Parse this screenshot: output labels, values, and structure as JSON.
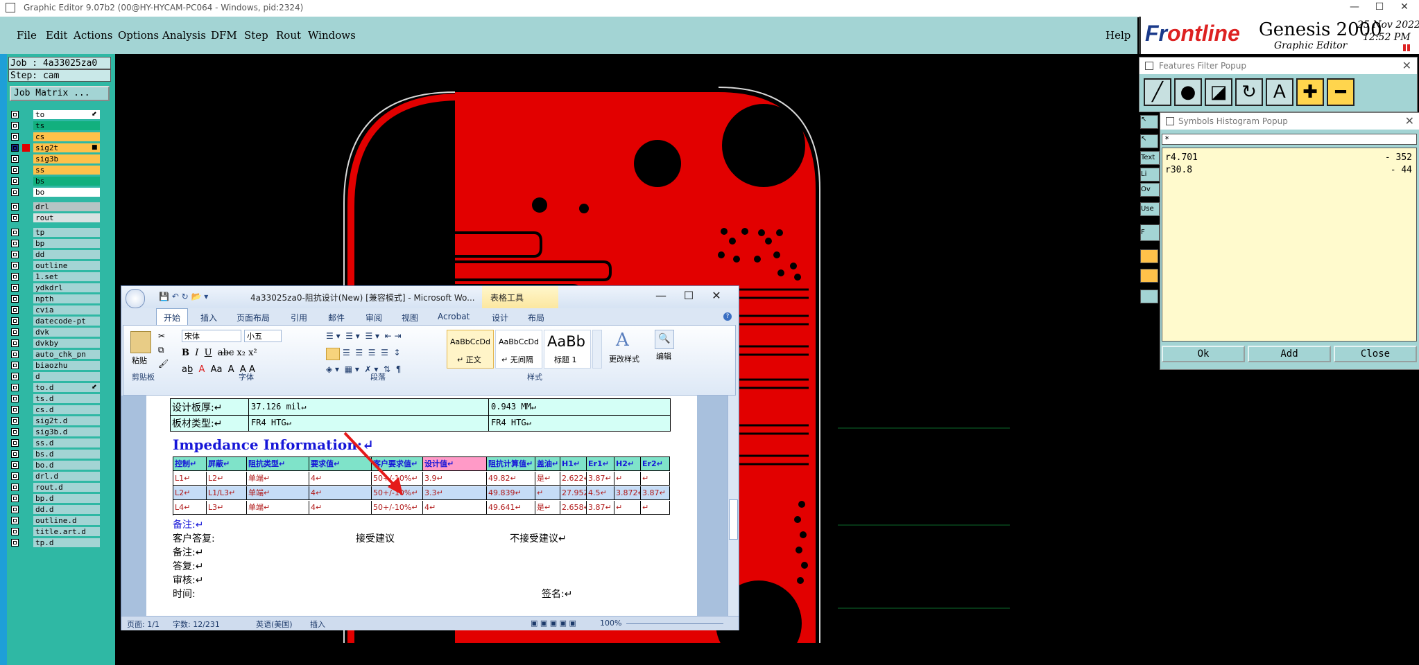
{
  "frame": {
    "title": "Graphic Editor 9.07b2 (00@HY-HYCAM-PC064 - Windows, pid:2324)"
  },
  "menu": {
    "items": [
      "File",
      "Edit",
      "Actions",
      "Options",
      "Analysis",
      "DFM",
      "Step",
      "Rout",
      "Windows"
    ],
    "help": "Help"
  },
  "logo": {
    "brand_front": "Fr",
    "brand_rest": "ontline",
    "product": "Genesis 2000",
    "subtitle": "Graphic Editor",
    "date": "25 Nov 2022",
    "time": "12:52 PM"
  },
  "job": {
    "job_label": "Job : 4a33025za0",
    "step_label": "Step: cam",
    "matrix_button": "Job Matrix ..."
  },
  "layers": [
    {
      "name": "to",
      "color": "#ffffff",
      "mark": "⬋"
    },
    {
      "name": "ts",
      "color": "#12b07e",
      "mark": ""
    },
    {
      "name": "cs",
      "color": "#ffc14a",
      "mark": ""
    },
    {
      "name": "sig2t",
      "color": "#ffc14a",
      "mark": "■",
      "selected": true
    },
    {
      "name": "sig3b",
      "color": "#ffc14a",
      "mark": ""
    },
    {
      "name": "ss",
      "color": "#ffc14a",
      "mark": ""
    },
    {
      "name": "bs",
      "color": "#12b07e",
      "mark": ""
    },
    {
      "name": "bo",
      "color": "#ffffff",
      "mark": ""
    },
    {
      "name": "drl",
      "color": "#b6c4c4",
      "mark": ""
    },
    {
      "name": "rout",
      "color": "#d8e2e2",
      "mark": ""
    },
    {
      "name": "tp",
      "color": "#a3d4d4",
      "mark": ""
    },
    {
      "name": "bp",
      "color": "#a3d4d4",
      "mark": ""
    },
    {
      "name": "dd",
      "color": "#a3d4d4",
      "mark": ""
    },
    {
      "name": "outline",
      "color": "#a3d4d4",
      "mark": ""
    },
    {
      "name": "1.set",
      "color": "#a3d4d4",
      "mark": ""
    },
    {
      "name": "ydkdrl",
      "color": "#a3d4d4",
      "mark": ""
    },
    {
      "name": "npth",
      "color": "#a3d4d4",
      "mark": ""
    },
    {
      "name": "cvia",
      "color": "#a3d4d4",
      "mark": ""
    },
    {
      "name": "datecode-pt",
      "color": "#a3d4d4",
      "mark": ""
    },
    {
      "name": "dvk",
      "color": "#a3d4d4",
      "mark": ""
    },
    {
      "name": "dvkby",
      "color": "#a3d4d4",
      "mark": ""
    },
    {
      "name": "auto_chk_pn",
      "color": "#a3d4d4",
      "mark": ""
    },
    {
      "name": "biaozhu",
      "color": "#a3d4d4",
      "mark": ""
    },
    {
      "name": "d",
      "color": "#a3d4d4",
      "mark": ""
    },
    {
      "name": "to.d",
      "color": "#a3d4d4",
      "mark": "⬋"
    },
    {
      "name": "ts.d",
      "color": "#a3d4d4",
      "mark": ""
    },
    {
      "name": "cs.d",
      "color": "#a3d4d4",
      "mark": ""
    },
    {
      "name": "sig2t.d",
      "color": "#a3d4d4",
      "mark": ""
    },
    {
      "name": "sig3b.d",
      "color": "#a3d4d4",
      "mark": ""
    },
    {
      "name": "ss.d",
      "color": "#a3d4d4",
      "mark": ""
    },
    {
      "name": "bs.d",
      "color": "#a3d4d4",
      "mark": ""
    },
    {
      "name": "bo.d",
      "color": "#a3d4d4",
      "mark": ""
    },
    {
      "name": "drl.d",
      "color": "#a3d4d4",
      "mark": ""
    },
    {
      "name": "rout.d",
      "color": "#a3d4d4",
      "mark": ""
    },
    {
      "name": "bp.d",
      "color": "#a3d4d4",
      "mark": ""
    },
    {
      "name": "dd.d",
      "color": "#a3d4d4",
      "mark": ""
    },
    {
      "name": "outline.d",
      "color": "#a3d4d4",
      "mark": ""
    },
    {
      "name": "title.art.d",
      "color": "#a3d4d4",
      "mark": ""
    },
    {
      "name": "tp.d",
      "color": "#a3d4d4",
      "mark": ""
    }
  ],
  "word": {
    "title": "4a33025za0-阻抗设计(New) [兼容模式] - Microsoft Wo...",
    "context_tab": "表格工具",
    "tabs": [
      "开始",
      "插入",
      "页面布局",
      "引用",
      "邮件",
      "审阅",
      "视图",
      "Acrobat",
      "设计",
      "布局"
    ],
    "ribbon": {
      "paste": "粘贴",
      "font_name": "宋体",
      "font_size": "小五",
      "styles": [
        "AaBbCcDd",
        "AaBbCcDd",
        "AaBb"
      ],
      "style_names": [
        "↵ 正文",
        "↵ 无间隔",
        "标题 1"
      ],
      "change_styles": "更改样式",
      "edit": "编辑",
      "groups": [
        "剪贴板",
        "字体",
        "段落",
        "样式"
      ]
    },
    "doc": {
      "row1": [
        "设计板厚:↵",
        "37.126 mil↵",
        "0.943 MM↵"
      ],
      "row2": [
        "板材类型:↵",
        "FR4 HTG↵",
        "FR4 HTG↵"
      ],
      "heading": "Impedance Information:↵",
      "table_header": [
        "控制↵",
        "屏蔽↵",
        "阻抗类型↵",
        "要求值↵",
        "客户要求值↵",
        "设计值↵",
        "阻抗计算值↵",
        "盖油↵",
        "H1↵",
        "Er1↵",
        "H2↵",
        "Er2↵"
      ],
      "table_rows": [
        [
          "L1↵",
          "L2↵",
          "单端↵",
          "4↵",
          "50+/-10%↵",
          "3.9↵",
          "49.82↵",
          "是↵",
          "2.622↵",
          "3.87↵",
          "↵",
          "↵"
        ],
        [
          "L2↵",
          "L1/L3↵",
          "单端↵",
          "4↵",
          "50+/-10%↵",
          "3.3↵",
          "49.839↵",
          "↵",
          "27.952↵",
          "4.5↵",
          "3.872↵",
          "3.87↵"
        ],
        [
          "L4↵",
          "L3↵",
          "单端↵",
          "4↵",
          "50+/-10%↵",
          "4↵",
          "49.641↵",
          "是↵",
          "2.658↵",
          "3.87↵",
          "↵",
          "↵"
        ]
      ],
      "note1": "备注:↵",
      "reply_label": "客户答复:",
      "accept": "接受建议",
      "reject": "不接受建议↵",
      "note2": "备注:↵",
      "answer": "答复:↵",
      "review": "审核:↵",
      "time": "时间:",
      "sign": "签名:↵"
    },
    "status": {
      "page": "页面: 1/1",
      "words": "字数: 12/231",
      "lang": "英语(美国)",
      "insert": "插入",
      "zoom": "100%"
    }
  },
  "features_popup": {
    "title": "Features Filter Popup"
  },
  "symbols_popup": {
    "title": "Symbols Histogram Popup",
    "filter": "*",
    "rows": [
      {
        "sym": "r4.701",
        "count": "- 352"
      },
      {
        "sym": "r30.8",
        "count": "- 44"
      }
    ],
    "buttons": [
      "Ok",
      "Add",
      "Close"
    ]
  },
  "peek_labels": {
    "text": "Text",
    "li": "Li",
    "ov": "Ov",
    "use": "Use",
    "f": "F"
  }
}
